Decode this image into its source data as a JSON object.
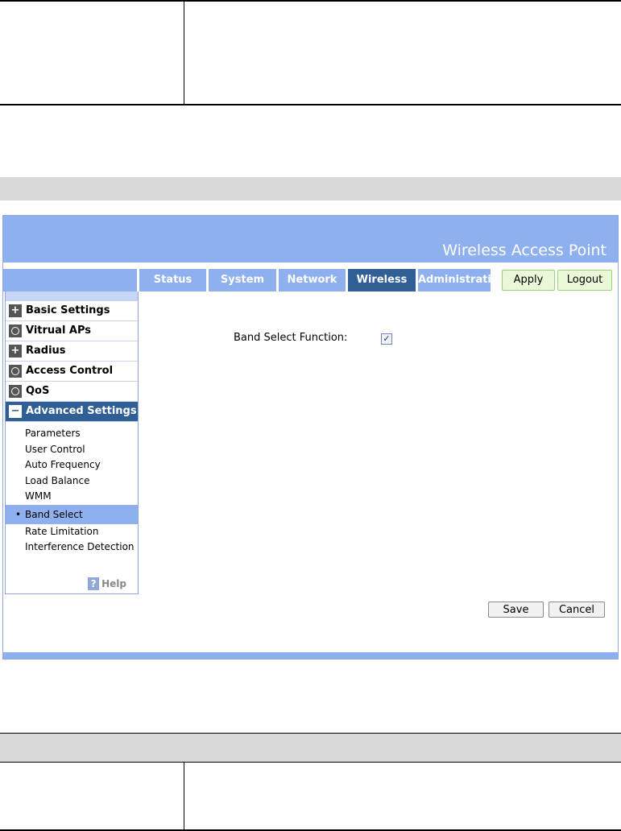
{
  "header": {
    "title": "Wireless Access Point"
  },
  "tabs": [
    {
      "label": "Status"
    },
    {
      "label": "System"
    },
    {
      "label": "Network"
    },
    {
      "label": "Wireless",
      "active": true
    },
    {
      "label": "Administration"
    }
  ],
  "actions": {
    "apply": "Apply",
    "logout": "Logout"
  },
  "sidebar": {
    "items": [
      {
        "label": "Basic Settings",
        "icon": "plus-icon"
      },
      {
        "label": "Vitrual APs",
        "icon": "circle-icon"
      },
      {
        "label": "Radius",
        "icon": "plus-icon"
      },
      {
        "label": "Access Control",
        "icon": "circle-icon"
      },
      {
        "label": "QoS",
        "icon": "circle-icon"
      },
      {
        "label": "Advanced Settings",
        "icon": "minus-icon",
        "expanded": true
      }
    ],
    "subitems": [
      {
        "label": "Parameters"
      },
      {
        "label": "User Control"
      },
      {
        "label": "Auto Frequency"
      },
      {
        "label": "Load Balance"
      },
      {
        "label": "WMM"
      },
      {
        "label": "Band Select",
        "active": true
      },
      {
        "label": "Rate Limitation"
      },
      {
        "label": "Interference Detection"
      }
    ],
    "help_label": "Help"
  },
  "main": {
    "band_select_label": "Band Select Function:",
    "band_select_checked": true,
    "save_label": "Save",
    "cancel_label": "Cancel"
  },
  "colors": {
    "banner": "#8fb0ee",
    "active_tab": "#2f5f95",
    "green_button": "#e9f8d6"
  }
}
